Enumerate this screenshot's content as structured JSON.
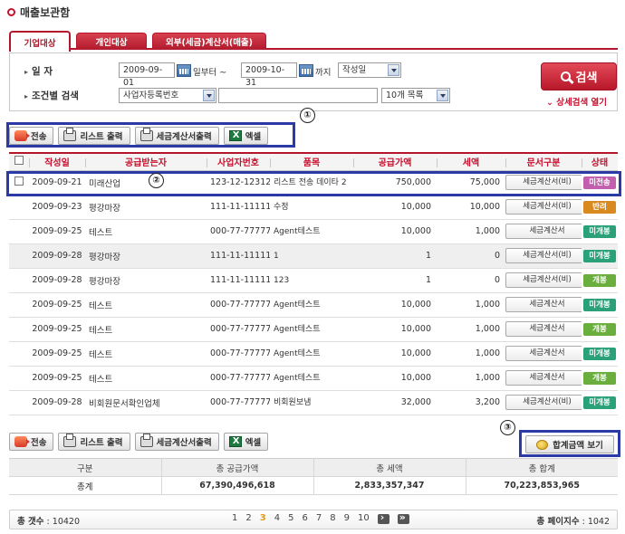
{
  "page": {
    "title": "매출보관함"
  },
  "tabs": [
    {
      "label": "기업대상",
      "active": true
    },
    {
      "label": "개인대상",
      "active": false
    },
    {
      "label": "외부(세금)계산서(매출)",
      "active": false
    }
  ],
  "search": {
    "date_label": "일    자",
    "date_from": "2009-09-01",
    "from_suffix": "일부터 ~",
    "date_to": "2009-10-31",
    "to_suffix": "까지",
    "date_type": "작성일",
    "cond_label": "조건별 검색",
    "cond_field": "사업자등록번호",
    "cond_value": "",
    "page_size": "10개 목록",
    "search_button": "검색",
    "detail_link": "상세검색 열기"
  },
  "toolbar": {
    "send": "전송",
    "list_print": "리스트 출력",
    "invoice_print": "세금계산서출력",
    "excel": "엑셀"
  },
  "annotations": [
    "①",
    "②",
    "③"
  ],
  "columns": [
    "작성일",
    "공급받는자",
    "사업자번호",
    "품목",
    "공급가액",
    "세액",
    "문서구분",
    "상태"
  ],
  "rows": [
    {
      "date": "2009-09-21",
      "receiver": "미래산업",
      "bizno": "123-12-12312",
      "item": "리스트 전송 데이타 2",
      "supply": "750,000",
      "tax": "75,000",
      "doc": "세금계산서(비)",
      "status": "미전송",
      "status_color": "#c25fae",
      "has_check": true,
      "grey": false
    },
    {
      "date": "2009-09-23",
      "receiver": "평강마장",
      "bizno": "111-11-11111",
      "item": "수정",
      "supply": "10,000",
      "tax": "10,000",
      "doc": "세금계산서(비)",
      "status": "반려",
      "status_color": "#d98a1e",
      "has_check": false,
      "grey": false
    },
    {
      "date": "2009-09-25",
      "receiver": "테스트",
      "bizno": "000-77-77777",
      "item": "Agent테스트",
      "supply": "10,000",
      "tax": "1,000",
      "doc": "세금계산서",
      "status": "미개봉",
      "status_color": "#2aa179",
      "has_check": false,
      "grey": false
    },
    {
      "date": "2009-09-28",
      "receiver": "평강마장",
      "bizno": "111-11-11111",
      "item": "1",
      "supply": "1",
      "tax": "0",
      "doc": "세금계산서(비)",
      "status": "미개봉",
      "status_color": "#2aa179",
      "has_check": false,
      "grey": true
    },
    {
      "date": "2009-09-28",
      "receiver": "평강마장",
      "bizno": "111-11-11111",
      "item": "123",
      "supply": "1",
      "tax": "0",
      "doc": "세금계산서(비)",
      "status": "개봉",
      "status_color": "#6aaf3d",
      "has_check": false,
      "grey": false
    },
    {
      "date": "2009-09-25",
      "receiver": "테스트",
      "bizno": "000-77-77777",
      "item": "Agent테스트",
      "supply": "10,000",
      "tax": "1,000",
      "doc": "세금계산서",
      "status": "미개봉",
      "status_color": "#2aa179",
      "has_check": false,
      "grey": false
    },
    {
      "date": "2009-09-25",
      "receiver": "테스트",
      "bizno": "000-77-77777",
      "item": "Agent테스트",
      "supply": "10,000",
      "tax": "1,000",
      "doc": "세금계산서",
      "status": "개봉",
      "status_color": "#6aaf3d",
      "has_check": false,
      "grey": false
    },
    {
      "date": "2009-09-25",
      "receiver": "테스트",
      "bizno": "000-77-77777",
      "item": "Agent테스트",
      "supply": "10,000",
      "tax": "1,000",
      "doc": "세금계산서",
      "status": "미개봉",
      "status_color": "#2aa179",
      "has_check": false,
      "grey": false
    },
    {
      "date": "2009-09-25",
      "receiver": "테스트",
      "bizno": "000-77-77777",
      "item": "Agent테스트",
      "supply": "10,000",
      "tax": "1,000",
      "doc": "세금계산서",
      "status": "개봉",
      "status_color": "#6aaf3d",
      "has_check": false,
      "grey": false
    },
    {
      "date": "2009-09-28",
      "receiver": "비회원문서확인업체",
      "bizno": "000-77-77777",
      "item": "비회원보냄",
      "supply": "32,000",
      "tax": "3,200",
      "doc": "세금계산서(비)",
      "status": "미개봉",
      "status_color": "#2aa179",
      "has_check": false,
      "grey": false
    }
  ],
  "sum_button": "합계금액 보기",
  "summary": {
    "headers": [
      "구분",
      "총 공급가액",
      "총 세액",
      "총 합계"
    ],
    "values": [
      "총계",
      "67,390,496,618",
      "2,833,357,347",
      "70,223,853,965"
    ]
  },
  "footer": {
    "total_count_label": "총 갯수",
    "total_count": "10420",
    "pages": [
      "1",
      "2",
      "3",
      "4",
      "5",
      "6",
      "7",
      "8",
      "9",
      "10"
    ],
    "current_page": "3",
    "total_pages_label": "총 페이지수",
    "total_pages": "1042"
  }
}
